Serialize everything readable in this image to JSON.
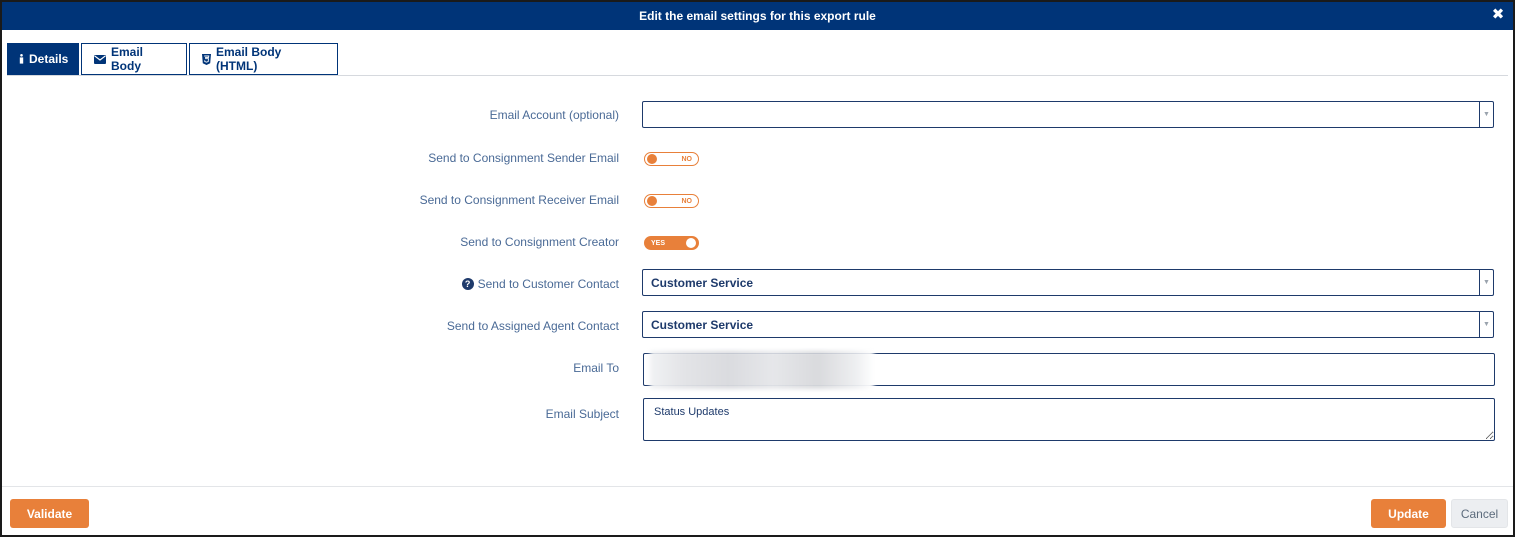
{
  "dialog": {
    "title": "Edit the email settings for this export rule"
  },
  "tabs": [
    {
      "label": "Details",
      "icon": "info-icon",
      "active": true
    },
    {
      "label": "Email Body",
      "icon": "envelope-icon",
      "active": false
    },
    {
      "label": "Email Body (HTML)",
      "icon": "html5-icon",
      "active": false
    }
  ],
  "form": {
    "email_account": {
      "label": "Email Account (optional)",
      "value": ""
    },
    "send_sender": {
      "label": "Send to Consignment Sender Email",
      "state": "NO"
    },
    "send_receiver": {
      "label": "Send to Consignment Receiver Email",
      "state": "NO"
    },
    "send_creator": {
      "label": "Send to Consignment Creator",
      "state": "YES"
    },
    "customer_contact": {
      "label": "Send to Customer Contact",
      "value": "Customer Service"
    },
    "agent_contact": {
      "label": "Send to Assigned Agent Contact",
      "value": "Customer Service"
    },
    "email_to": {
      "label": "Email To",
      "value": ""
    },
    "email_subject": {
      "label": "Email Subject",
      "value": "Status Updates"
    }
  },
  "footer": {
    "validate_label": "Validate",
    "update_label": "Update",
    "cancel_label": "Cancel"
  },
  "colors": {
    "primary": "#003478",
    "accent": "#e8803a",
    "label": "#4a6a96"
  }
}
